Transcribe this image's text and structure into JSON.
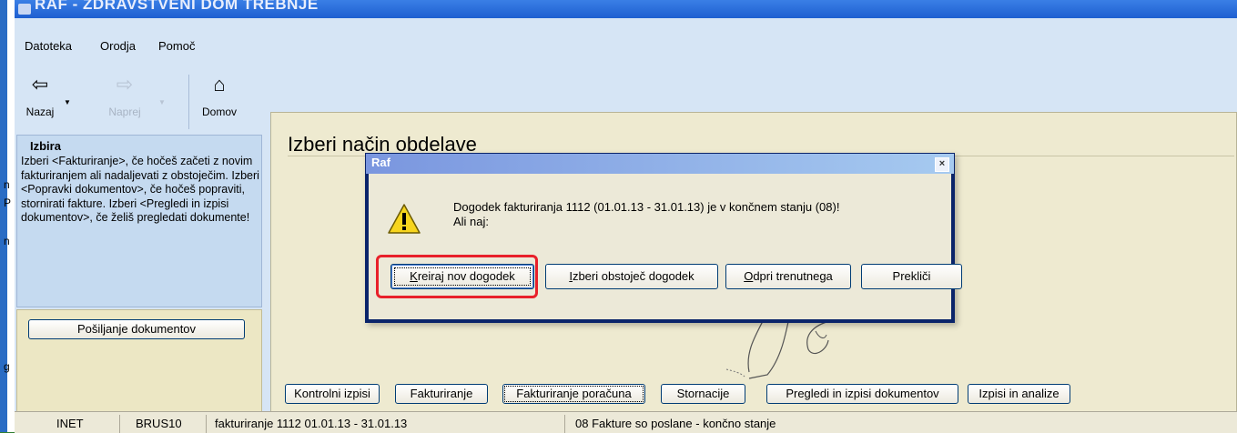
{
  "window": {
    "title": "RAF - ZDRAVSTVENI DOM TREBNJE"
  },
  "menu": [
    "Datoteka",
    "Orodja",
    "Pomoč"
  ],
  "toolbar": {
    "back": "Nazaj",
    "forward": "Naprej",
    "home": "Domov"
  },
  "left_fragments": [
    "n",
    "P",
    "n",
    "g"
  ],
  "info_panel": {
    "title": "Izbira",
    "text": "Izberi <Fakturiranje>, če hočeš začeti z novim fakturiranjem ali nadaljevati z obstoječim. Izberi <Popravki dokumentov>, če hočeš popraviti, stornirati fakture. Izberi <Pregledi in izpisi dokumentov>, če želiš pregledati dokumente!"
  },
  "send_button": "Pošiljanje dokumentov",
  "main": {
    "heading": "Izberi način obdelave"
  },
  "bottom_buttons": [
    "Kontrolni izpisi",
    "Fakturiranje",
    "Fakturiranje poračuna",
    "Stornacije",
    "Pregledi in izpisi dokumentov",
    "Izpisi in analize"
  ],
  "statusbar": {
    "cells": [
      "INET",
      "BRUS10",
      "fakturiranje 1112  01.01.13 - 31.01.13",
      "08 Fakture so poslane - končno stanje"
    ]
  },
  "dialog": {
    "title": "Raf",
    "close": "×",
    "message_line1": "Dogodek fakturiranja 1112 (01.01.13 - 31.01.13) je v končnem stanju (08)!",
    "message_line2": "Ali naj:",
    "buttons": [
      {
        "mnemonic": "K",
        "rest": "reiraj nov dogodek"
      },
      {
        "mnemonic": "I",
        "rest": "zberi obstoječ dogodek"
      },
      {
        "mnemonic": "O",
        "rest": "dpri trenutnega"
      },
      {
        "mnemonic": "",
        "rest": "Prekliči"
      }
    ]
  },
  "colors": {
    "titlebar": "#1e5fd0",
    "panel_blue": "#c5daf0",
    "content_bg": "#eeead0",
    "dialog_titlebar": "#7a96df",
    "highlight": "#e8202a"
  }
}
